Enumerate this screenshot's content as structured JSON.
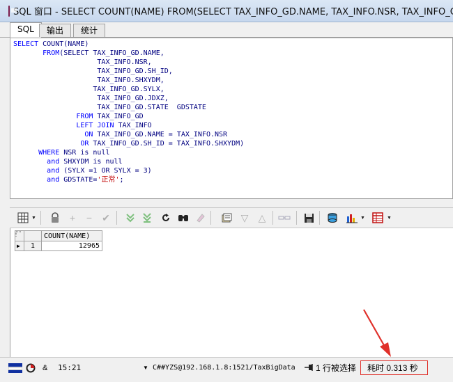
{
  "window": {
    "title": "SQL 窗口 - SELECT COUNT(NAME) FROM(SELECT TAX_INFO_GD.NAME, TAX_INFO.NSR, TAX_INFO_GD.SH_I"
  },
  "tabs": [
    {
      "label": "SQL"
    },
    {
      "label": "输出"
    },
    {
      "label": "统计"
    }
  ],
  "sql_lines": [
    {
      "pre": "",
      "kw": "SELECT",
      "rest": " COUNT(NAME)"
    },
    {
      "pre": "       ",
      "kw": "FROM",
      "rest": "(SELECT TAX_INFO_GD.NAME,"
    },
    {
      "pre": "",
      "kw": "",
      "rest": "                    TAX_INFO.NSR,"
    },
    {
      "pre": "",
      "kw": "",
      "rest": "                    TAX_INFO_GD.SH_ID,"
    },
    {
      "pre": "",
      "kw": "",
      "rest": "                    TAX_INFO.SHXYDM,"
    },
    {
      "pre": "",
      "kw": "",
      "rest": "                   TAX_INFO_GD.SYLX,"
    },
    {
      "pre": "",
      "kw": "",
      "rest": "                    TAX_INFO_GD.JDXZ,"
    },
    {
      "pre": "",
      "kw": "",
      "rest": "                    TAX_INFO_GD.STATE  GDSTATE"
    },
    {
      "pre": "               ",
      "kw": "FROM",
      "rest": " TAX_INFO_GD"
    },
    {
      "pre": "               ",
      "kw": "LEFT JOIN",
      "rest": " TAX_INFO"
    },
    {
      "pre": "                 ",
      "kw": "ON",
      "rest": " TAX_INFO_GD.NAME = TAX_INFO.NSR"
    },
    {
      "pre": "                ",
      "kw": "OR",
      "rest": " TAX_INFO_GD.SH_ID = TAX_INFO.SHXYDM)"
    },
    {
      "pre": "      ",
      "kw": "WHERE",
      "rest": " NSR is null"
    },
    {
      "pre": "        ",
      "kw": "and",
      "rest": " SHXYDM is null"
    },
    {
      "pre": "        ",
      "kw": "and",
      "rest": " (SYLX =1 OR SYLX = 3)"
    },
    {
      "pre": "        ",
      "kw": "and",
      "rest": " GDSTATE=",
      "str": "'正常'",
      "tail": ";"
    }
  ],
  "toolbar": {
    "icons": [
      "grid-icon",
      "lock-icon",
      "add-row-icon",
      "delete-row-icon",
      "post-icon",
      "fetch-next-icon",
      "fetch-last-icon",
      "refresh-icon",
      "find-icon",
      "clear-icon",
      "query-by-example-icon",
      "filter-down-icon",
      "filter-up-icon",
      "link-icon",
      "save-icon",
      "export-icon",
      "chart-icon",
      "table-view-icon"
    ]
  },
  "result": {
    "columns": [
      "COUNT(NAME)"
    ],
    "rows": [
      {
        "num": "1",
        "value": "12965"
      }
    ]
  },
  "status": {
    "time": "15:21",
    "amp": "&",
    "connection": "C##YZS@192.168.1.8:1521/TaxBigData",
    "rows_selected": "1 行被选择",
    "elapsed": "耗时 0.313 秒"
  },
  "colors": {
    "keyword": "#0000ff",
    "identifier": "#000080",
    "string": "#c00000",
    "annotation": "#e0302a"
  }
}
